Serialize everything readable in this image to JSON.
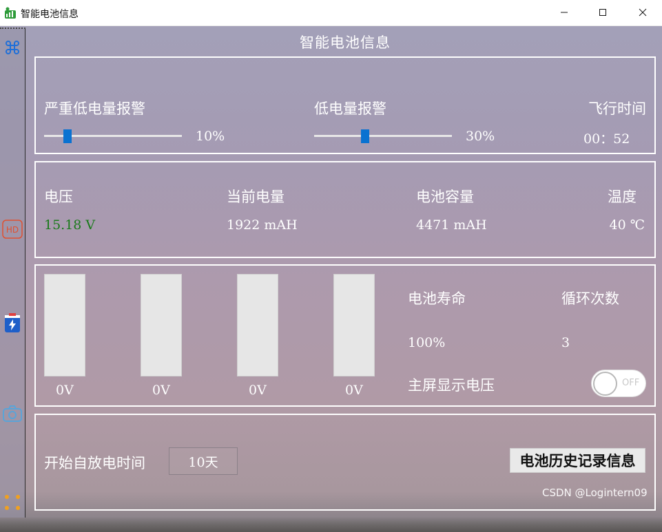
{
  "window": {
    "title": "智能电池信息",
    "icon": "battery-app-icon",
    "controls": [
      "minimize-icon",
      "maximize-icon",
      "close-icon"
    ]
  },
  "sidebar": {
    "icons": [
      "command-icon",
      "hd-icon",
      "battery-charge-icon",
      "camera-icon",
      "more-dots-icon"
    ]
  },
  "header": {
    "title": "智能电池信息"
  },
  "alarms": {
    "critical_label": "严重低电量报警",
    "critical_value": "10%",
    "critical_level": 0.1,
    "low_label": "低电量报警",
    "low_value": "30%",
    "low_level": 0.3,
    "flight_time_label": "飞行时间",
    "flight_time_value": "00：52"
  },
  "status": {
    "voltage_label": "电压",
    "voltage_value": "15.18 V",
    "voltage_color": "#1a7a1a",
    "current_charge_label": "当前电量",
    "current_charge_value": "1922 mAH",
    "capacity_label": "电池容量",
    "capacity_value": "4471 mAH",
    "temperature_label": "温度",
    "temperature_value": "40 ℃"
  },
  "cells": [
    {
      "voltage": "0V"
    },
    {
      "voltage": "0V"
    },
    {
      "voltage": "0V"
    },
    {
      "voltage": "0V"
    }
  ],
  "health": {
    "life_label": "电池寿命",
    "life_value": "100%",
    "cycles_label": "循环次数",
    "cycles_value": "3",
    "main_screen_voltage_label": "主屏显示电压",
    "toggle_state": "OFF"
  },
  "discharge": {
    "label": "开始自放电时间",
    "value": "10天",
    "history_button": "电池历史记录信息"
  },
  "colors": {
    "accent": "#0a72d1",
    "panel_border": "#ffffff",
    "text": "#ffffff"
  },
  "watermark": "CSDN @Logintern09"
}
